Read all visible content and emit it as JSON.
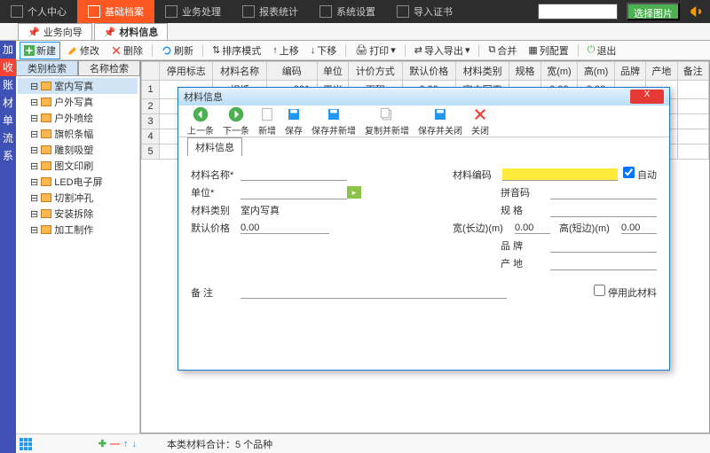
{
  "top": {
    "tabs": [
      "个人中心",
      "基础档案",
      "业务处理",
      "报表统计",
      "系统设置",
      "导入证书"
    ],
    "select_img": "选择图片"
  },
  "subtabs": [
    "业务向导",
    "材料信息"
  ],
  "leftnav": [
    "加",
    "收",
    "账",
    "材",
    "单",
    "流",
    "系"
  ],
  "toolbar": {
    "new": "新建",
    "edit": "修改",
    "del": "删除",
    "refresh": "刷新",
    "sort": "排序模式",
    "up": "上移",
    "down": "下移",
    "print": "打印",
    "impexp": "导入导出",
    "merge": "合并",
    "colcfg": "列配置",
    "exit": "退出"
  },
  "tree": {
    "tabs": [
      "类别检索",
      "名称检索"
    ],
    "items": [
      "室内写真",
      "户外写真",
      "户外喷绘",
      "旗帜条幅",
      "雕刻吸塑",
      "图文印刷",
      "LED电子屏",
      "切割冲孔",
      "安装拆除",
      "加工制作"
    ]
  },
  "grid": {
    "cols": [
      "",
      "停用标志",
      "材料名称",
      "编码",
      "单位",
      "计价方式",
      "默认价格",
      "材料类别",
      "规格",
      "宽(m)",
      "高(m)",
      "品牌",
      "产地",
      "备注"
    ],
    "rows": [
      [
        "1",
        "",
        "相纸",
        "snxz001",
        "平米",
        "面积",
        "0.00",
        "室内写真",
        "",
        "0.00",
        "0.00",
        "",
        "",
        ""
      ],
      [
        "2",
        "",
        "",
        "",
        "",
        "",
        "",
        "",
        "",
        "",
        "",
        "",
        "",
        ""
      ],
      [
        "3",
        "",
        "",
        "",
        "",
        "",
        "",
        "",
        "",
        "",
        "",
        "",
        "",
        ""
      ],
      [
        "4",
        "",
        "",
        "",
        "",
        "",
        "",
        "",
        "",
        "",
        "",
        "",
        "",
        ""
      ],
      [
        "5",
        "",
        "",
        "",
        "",
        "",
        "",
        "",
        "",
        "",
        "",
        "",
        "",
        ""
      ]
    ]
  },
  "dialog": {
    "title": "材料信息",
    "tools": {
      "prev": "上一条",
      "next": "下一条",
      "new": "新增",
      "save": "保存",
      "savenew": "保存并新增",
      "copynew": "复制并新增",
      "saveclose": "保存并关闭",
      "close": "关闭"
    },
    "tab": "材料信息",
    "fields": {
      "name": "材料名称*",
      "code": "材料编码",
      "auto": "自动",
      "unit": "单位*",
      "pinyin": "拼音码",
      "cat": "材料类别",
      "cat_val": "室内写真",
      "spec": "规   格",
      "price": "默认价格",
      "price_val": "0.00",
      "width": "宽(长边)(m)",
      "width_val": "0.00",
      "height": "高(短边)(m)",
      "height_val": "0.00",
      "brand": "品   牌",
      "origin": "产   地",
      "remark": "备   注",
      "disable": "停用此材料"
    }
  },
  "status": "本类材料合计：5 个品种"
}
